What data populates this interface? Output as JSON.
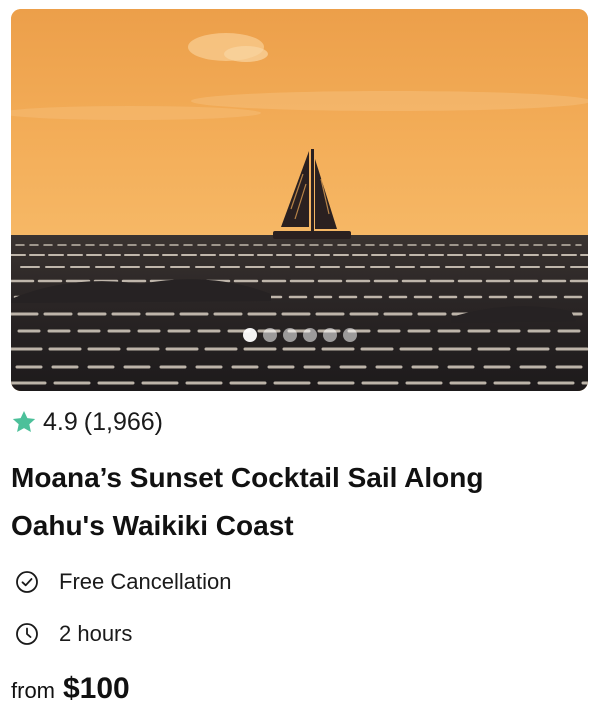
{
  "listing": {
    "image": {
      "alt": "Catamaran sailing at sunset on the ocean",
      "carousel_dots": 6,
      "active_dot": 0
    },
    "rating": {
      "score": "4.9",
      "count": "(1,966)",
      "star_color": "#4cc09a"
    },
    "title": "Moana’s Sunset Cocktail Sail Along Oahu's Waikiki Coast",
    "features": {
      "cancellation": {
        "icon": "check-circle-icon",
        "label": "Free Cancellation"
      },
      "duration": {
        "icon": "clock-icon",
        "label": "2 hours"
      }
    },
    "price": {
      "prefix": "from",
      "amount": "$100"
    }
  }
}
